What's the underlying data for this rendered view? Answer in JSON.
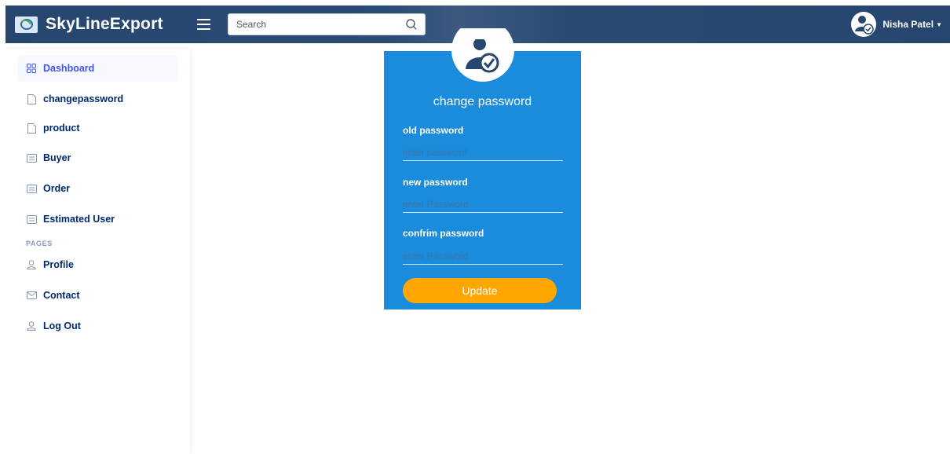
{
  "header": {
    "brand": "SkyLineExport",
    "search_placeholder": "Search",
    "user_name": "Nisha Patel"
  },
  "sidebar": {
    "items": [
      {
        "label": "Dashboard",
        "icon": "grid-icon",
        "active": true
      },
      {
        "label": "changepassword",
        "icon": "file-icon"
      },
      {
        "label": "product",
        "icon": "file-icon"
      },
      {
        "label": "Buyer",
        "icon": "list-icon"
      },
      {
        "label": "Order",
        "icon": "list-icon"
      },
      {
        "label": "Estimated User",
        "icon": "list-icon"
      }
    ],
    "pages_heading": "PAGES",
    "pages": [
      {
        "label": "Profile",
        "icon": "person-icon"
      },
      {
        "label": "Contact",
        "icon": "envelope-icon"
      },
      {
        "label": "Log Out",
        "icon": "person-icon"
      }
    ]
  },
  "form": {
    "title": "change password",
    "old_label": "old password",
    "old_placeholder": "enter password",
    "new_label": "new password",
    "new_placeholder": "enter Password",
    "confirm_label": "confrim password",
    "confirm_placeholder": "enter Password",
    "submit_label": "Update"
  },
  "colors": {
    "header": "#27466f",
    "card": "#1b8bdc",
    "button": "#ffa600",
    "nav_text": "#012970",
    "nav_active": "#4154f1"
  }
}
